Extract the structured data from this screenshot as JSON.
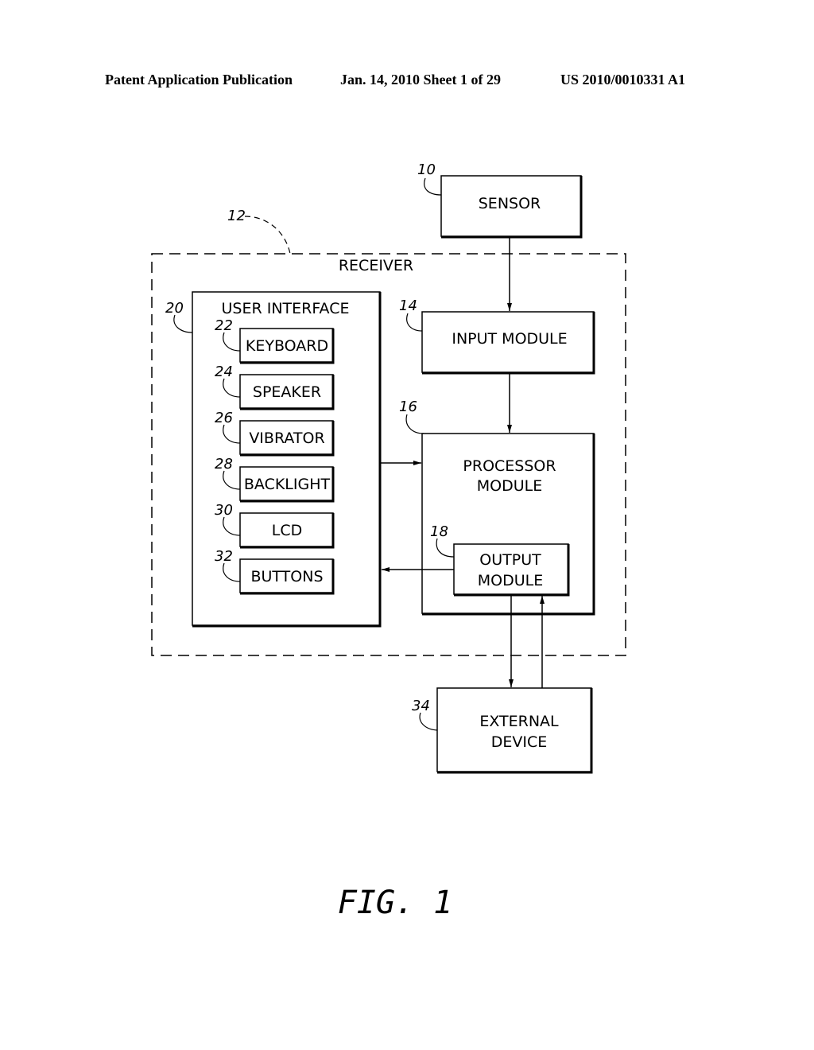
{
  "header": {
    "publication": "Patent Application Publication",
    "date_sheet": "Jan. 14, 2010  Sheet 1 of 29",
    "number": "US 2010/0010331 A1"
  },
  "diagram": {
    "sensor": {
      "ref": "10",
      "label": "SENSOR"
    },
    "receiver": {
      "ref": "12",
      "label": "RECEIVER"
    },
    "input_module": {
      "ref": "14",
      "label": "INPUT  MODULE"
    },
    "processor_module": {
      "ref": "16",
      "line1": "PROCESSOR",
      "line2": "MODULE"
    },
    "output_module": {
      "ref": "18",
      "line1": "OUTPUT",
      "line2": "MODULE"
    },
    "user_interface": {
      "ref": "20",
      "label": "USER  INTERFACE"
    },
    "ui_items": [
      {
        "ref": "22",
        "label": "KEYBOARD"
      },
      {
        "ref": "24",
        "label": "SPEAKER"
      },
      {
        "ref": "26",
        "label": "VIBRATOR"
      },
      {
        "ref": "28",
        "label": "BACKLIGHT"
      },
      {
        "ref": "30",
        "label": "LCD"
      },
      {
        "ref": "32",
        "label": "BUTTONS"
      }
    ],
    "external_device": {
      "ref": "34",
      "line1": "EXTERNAL",
      "line2": "DEVICE"
    }
  },
  "figure_label": "FIG.  1"
}
